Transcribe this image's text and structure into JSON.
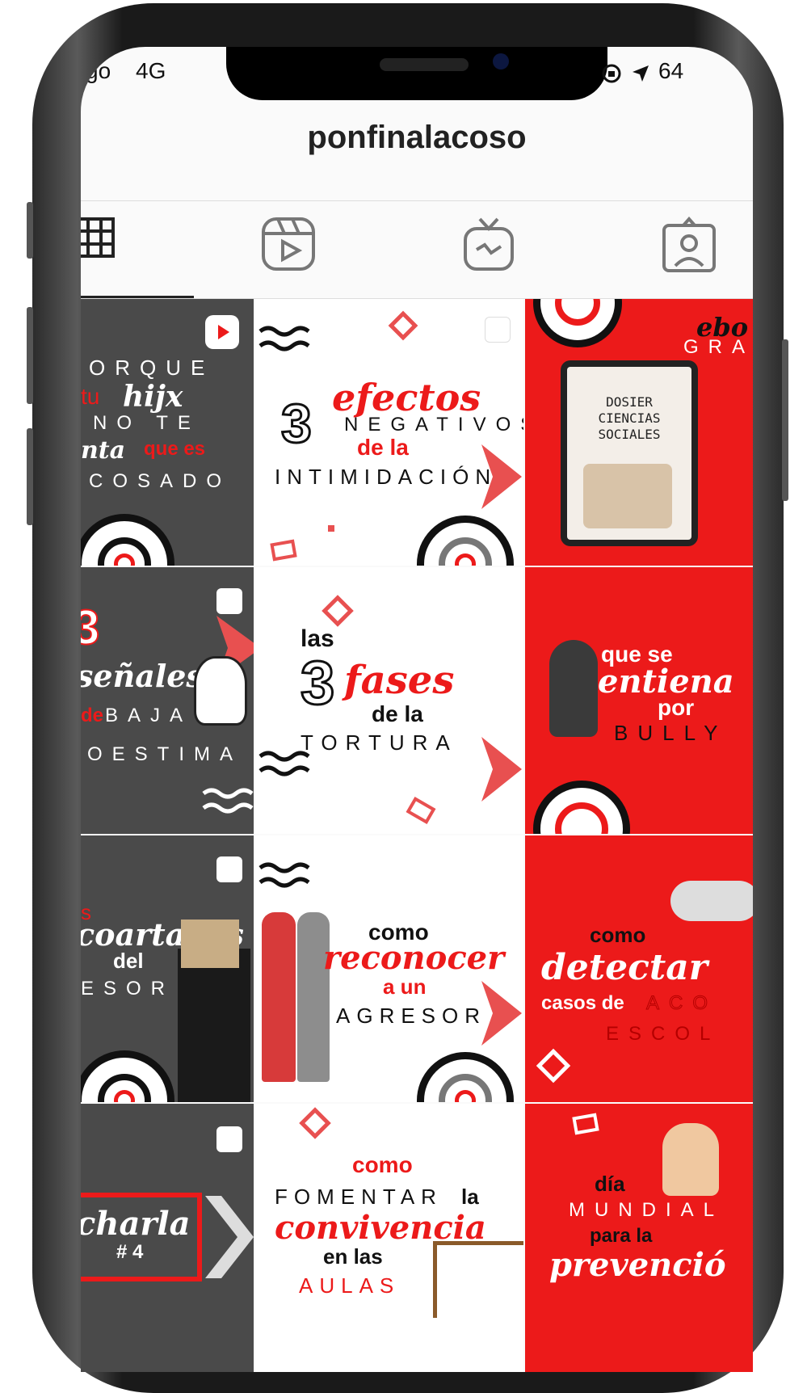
{
  "status_bar": {
    "carrier": "go",
    "network": "4G",
    "battery": "64"
  },
  "profile": {
    "username": "ponfinalacoso"
  },
  "tabs": [
    {
      "name": "grid",
      "icon": "grid-icon",
      "selected": true
    },
    {
      "name": "reels",
      "icon": "reels-icon",
      "selected": false
    },
    {
      "name": "igtv",
      "icon": "igtv-icon",
      "selected": false
    },
    {
      "name": "tagged",
      "icon": "tagged-icon",
      "selected": false
    }
  ],
  "posts": [
    {
      "lines": [
        "ORQUE",
        "tu",
        "hijx",
        "NO TE",
        "nta",
        "que es",
        "COSADO"
      ]
    },
    {
      "lines": [
        "3",
        "efectos",
        "NEGATIVOS",
        "de la",
        "INTIMIDACIÓN"
      ]
    },
    {
      "lines": [
        "ebo",
        "GRA",
        "DOSIER",
        "CIENCIAS",
        "SOCIALES"
      ]
    },
    {
      "lines": [
        "3",
        "señales",
        "de",
        "BAJA",
        "OESTIMA"
      ]
    },
    {
      "lines": [
        "las",
        "3",
        "fases",
        "de la",
        "TORTURA"
      ]
    },
    {
      "lines": [
        "que se",
        "entiena",
        "por",
        "BULLY"
      ]
    },
    {
      "lines": [
        "s",
        "coartadas",
        "del",
        "ESOR"
      ]
    },
    {
      "lines": [
        "como",
        "reconocer",
        "a un",
        "AGRESOR"
      ]
    },
    {
      "lines": [
        "como",
        "detectar",
        "casos de",
        "ACO",
        "ESCOL"
      ]
    },
    {
      "lines": [
        "charla",
        "# 4"
      ]
    },
    {
      "lines": [
        "como",
        "FOMENTAR",
        "la",
        "convivencia",
        "en las",
        "AULAS"
      ]
    },
    {
      "lines": [
        "día",
        "MUNDIAL",
        "para la",
        "prevenció"
      ]
    }
  ],
  "colors": {
    "red": "#ec1a1a",
    "dark": "#4a4a4a",
    "white": "#ffffff"
  }
}
